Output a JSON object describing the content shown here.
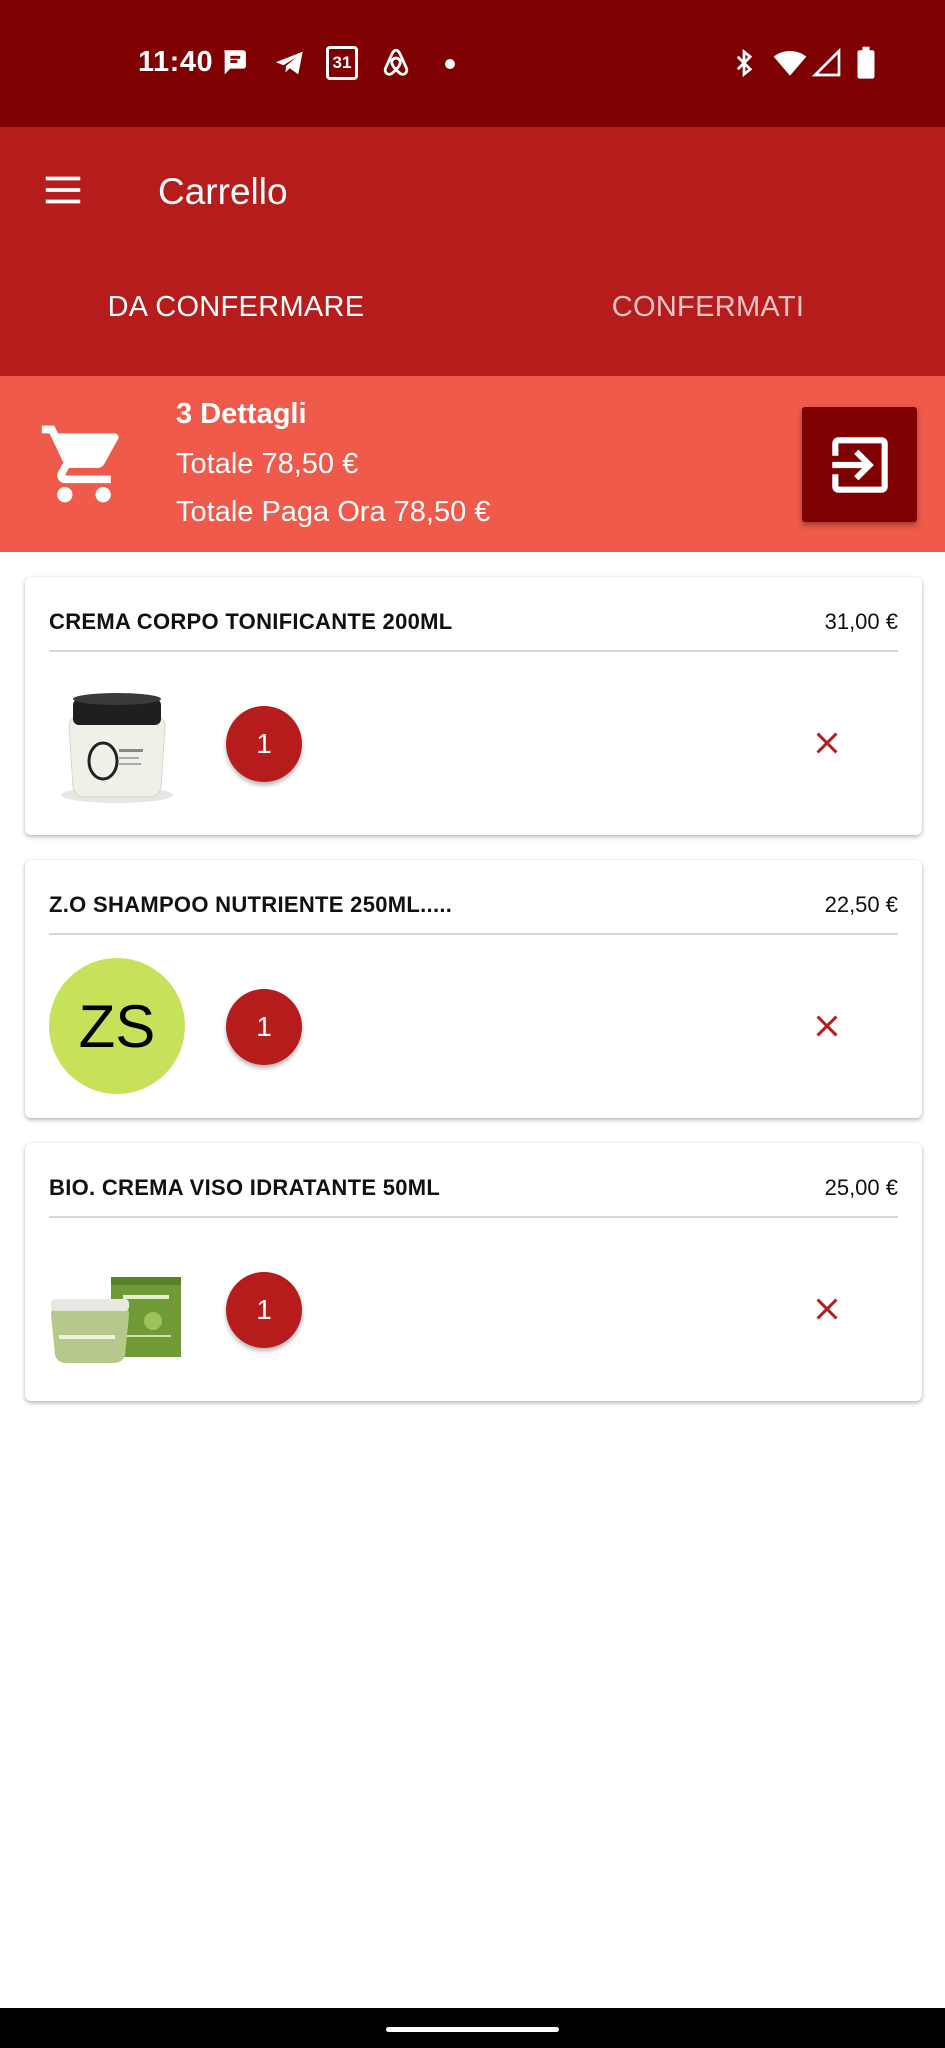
{
  "status_bar": {
    "time": "11:40",
    "calendar_day": "31",
    "icons": [
      "messages-icon",
      "telegram-icon",
      "calendar-icon",
      "airbnb-icon",
      "notification-dot-icon",
      "bluetooth-icon",
      "wifi-icon",
      "signal-icon",
      "battery-icon"
    ]
  },
  "app_bar": {
    "title": "Carrello",
    "menu_icon": "hamburger-menu-icon"
  },
  "tabs": [
    {
      "label": "DA CONFERMARE",
      "active": true
    },
    {
      "label": "CONFERMATI",
      "active": false
    }
  ],
  "summary": {
    "count": "3 Dettagli",
    "total": "Totale 78,50 €",
    "pay_now": "Totale Paga Ora 78,50 €",
    "cart_icon": "shopping-cart-icon",
    "checkout_icon": "exit-to-app-icon"
  },
  "items": [
    {
      "name": "CREMA CORPO TONIFICANTE 200ML",
      "price": "31,00 €",
      "quantity": "1",
      "thumbnail": "cream-jar-image"
    },
    {
      "name": "Z.O SHAMPOO NUTRIENTE 250ML.....",
      "price": "22,50 €",
      "quantity": "1",
      "thumbnail": "initials",
      "initials": "ZS"
    },
    {
      "name": "BIO. CREMA VISO IDRATANTE 50ML",
      "price": "25,00 €",
      "quantity": "1",
      "thumbnail": "green-cream-box-image"
    }
  ],
  "colors": {
    "status_bar": "#7f0000",
    "app_bar": "#b71c1c",
    "summary": "#ef5a4a",
    "accent": "#b71c1c",
    "initials_bg": "#c6e25a"
  }
}
